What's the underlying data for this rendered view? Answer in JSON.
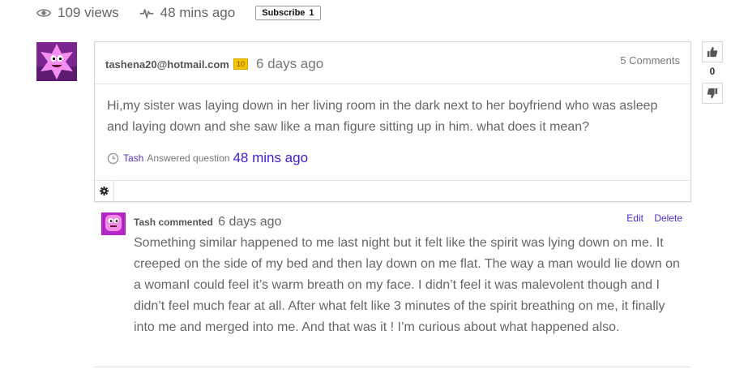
{
  "meta": {
    "views": "109 views",
    "activity": "48 mins ago",
    "subscribe_label": "Subscribe",
    "subscribe_count": "1"
  },
  "question": {
    "author": "tashena20@hotmail.com",
    "points": "10",
    "posted": "6 days ago",
    "comments_count": "5 Comments",
    "body": "Hi,my sister was laying down in her living room in the dark next to her boyfriend who was asleep and laying down and she saw like a man figure sitting up in him. what does it mean?",
    "answered_by": "Tash",
    "answered_text": "Answered question",
    "answered_when": "48 mins ago"
  },
  "votes": {
    "count": "0"
  },
  "comment": {
    "author": "Tash commented",
    "when": "6 days ago",
    "edit_label": "Edit",
    "delete_label": "Delete",
    "body": "Something similar happened to me last night but it felt like the spirit was lying down on me. It creeped on the side of my bed and then lay down on me flat. The way a man would lie down on a womanI could feel it’s warm breath on my face. I didn’t feel it was malevolent though and I didn’t feel much fear at all. After what felt like 3 minutes of the spirit breathing on me, it finally into me and merged into me. And that was it ! I’m curious about what happened also."
  },
  "colors": {
    "link": "#4a2fd0",
    "badge": "#f5c400",
    "avatar": "#8b2a9c"
  },
  "icons": [
    "eye-icon",
    "pulse-icon",
    "clock-icon",
    "gear-icon",
    "thumbs-up-icon",
    "thumbs-down-icon"
  ]
}
